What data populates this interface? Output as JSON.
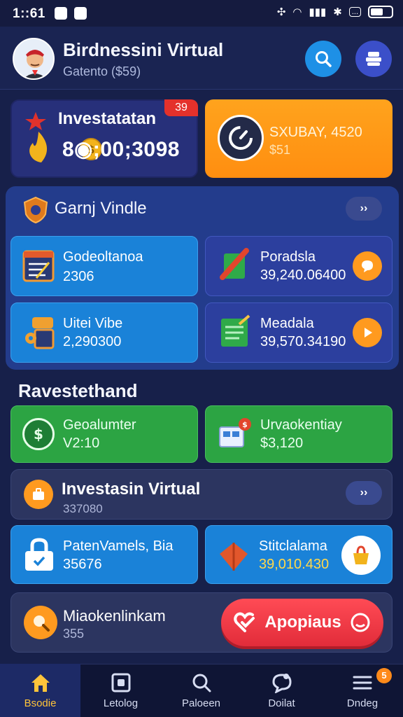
{
  "status_bar": {
    "time": "1::61",
    "battery_label": "..."
  },
  "header": {
    "title": "Birdnessini Virtual",
    "subtitle": "Gatento ($59)"
  },
  "summary": {
    "investment": {
      "title": "Investatatan",
      "value": "8◉;00;3098",
      "badge": "39"
    },
    "promo": {
      "title": "SXUBAY, 4520",
      "subtitle": "$51"
    }
  },
  "panel": {
    "title": "Garnj Vindle",
    "more": "››",
    "tiles": [
      {
        "label": "Godeoltanoa",
        "value": "2306"
      },
      {
        "label": "Poradsla",
        "value": "39,240.06400"
      },
      {
        "label": "Uitei Vibe",
        "value": "2,290300"
      },
      {
        "label": "Meadala",
        "value": "39,570.34190"
      }
    ]
  },
  "section": {
    "title": "Ravestethand",
    "tiles": [
      {
        "label": "Geoalumter",
        "value": "V2:10"
      },
      {
        "label": "Urvaokentiay",
        "value": "$3,120"
      }
    ]
  },
  "investasin": {
    "title": "Investasin Virtual",
    "value": "337080",
    "more": "››"
  },
  "row_blue": [
    {
      "label": "PatenVamels, Bia",
      "value": "35676"
    },
    {
      "label": "Stitclalama",
      "value": "39,010.430"
    }
  ],
  "last_card": {
    "label": "Miaokenlinkam",
    "value": "355",
    "button": "Apopiaus"
  },
  "bottom_nav": {
    "items": [
      {
        "label": "Bsodie"
      },
      {
        "label": "Letolog"
      },
      {
        "label": "Paloeen"
      },
      {
        "label": "Doilat"
      },
      {
        "label": "Dndeg",
        "badge": "5"
      }
    ]
  },
  "colors": {
    "background": "#17204a",
    "accent_orange": "#ff8e10",
    "accent_green": "#2ca443",
    "accent_blue": "#1a82d8",
    "accent_red": "#e22c3a",
    "active_nav": "#ffc43a"
  }
}
